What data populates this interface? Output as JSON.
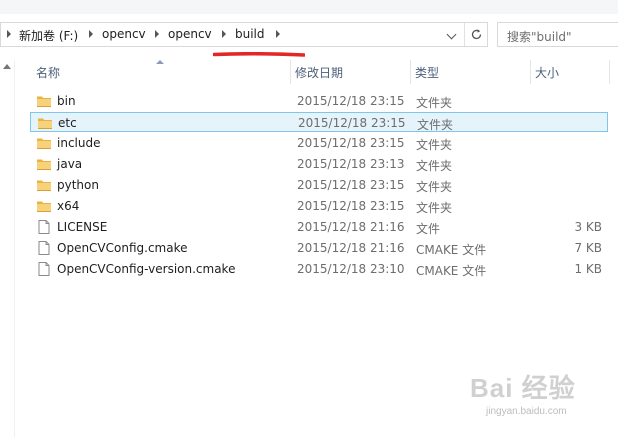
{
  "address_bar": {
    "crumbs": [
      "新加卷 (F:)",
      "opencv",
      "opencv",
      "build"
    ]
  },
  "search": {
    "placeholder": "搜索\"build\""
  },
  "columns": {
    "name": "名称",
    "date": "修改日期",
    "type": "类型",
    "size": "大小"
  },
  "files": [
    {
      "name": "bin",
      "date": "2015/12/18 23:15",
      "type": "文件夹",
      "size": "",
      "icon": "folder-icon",
      "selected": false
    },
    {
      "name": "etc",
      "date": "2015/12/18 23:15",
      "type": "文件夹",
      "size": "",
      "icon": "folder-icon",
      "selected": true
    },
    {
      "name": "include",
      "date": "2015/12/18 23:15",
      "type": "文件夹",
      "size": "",
      "icon": "folder-icon",
      "selected": false
    },
    {
      "name": "java",
      "date": "2015/12/18 23:13",
      "type": "文件夹",
      "size": "",
      "icon": "folder-icon",
      "selected": false
    },
    {
      "name": "python",
      "date": "2015/12/18 23:15",
      "type": "文件夹",
      "size": "",
      "icon": "folder-icon",
      "selected": false
    },
    {
      "name": "x64",
      "date": "2015/12/18 23:15",
      "type": "文件夹",
      "size": "",
      "icon": "folder-icon",
      "selected": false
    },
    {
      "name": "LICENSE",
      "date": "2015/12/18 21:16",
      "type": "文件",
      "size": "3 KB",
      "icon": "file-icon",
      "selected": false
    },
    {
      "name": "OpenCVConfig.cmake",
      "date": "2015/12/18 21:16",
      "type": "CMAKE 文件",
      "size": "7 KB",
      "icon": "file-icon",
      "selected": false
    },
    {
      "name": "OpenCVConfig-version.cmake",
      "date": "2015/12/18 23:10",
      "type": "CMAKE 文件",
      "size": "1 KB",
      "icon": "file-icon",
      "selected": false
    }
  ],
  "watermark": {
    "logo": "Bai 经验",
    "url": "jingyan.baidu.com"
  },
  "colors": {
    "selection_fill": "#e5f3fb",
    "selection_border": "#7fc6ea",
    "annotation_red": "#e32626",
    "folder_yellow": "#f2c15a"
  }
}
